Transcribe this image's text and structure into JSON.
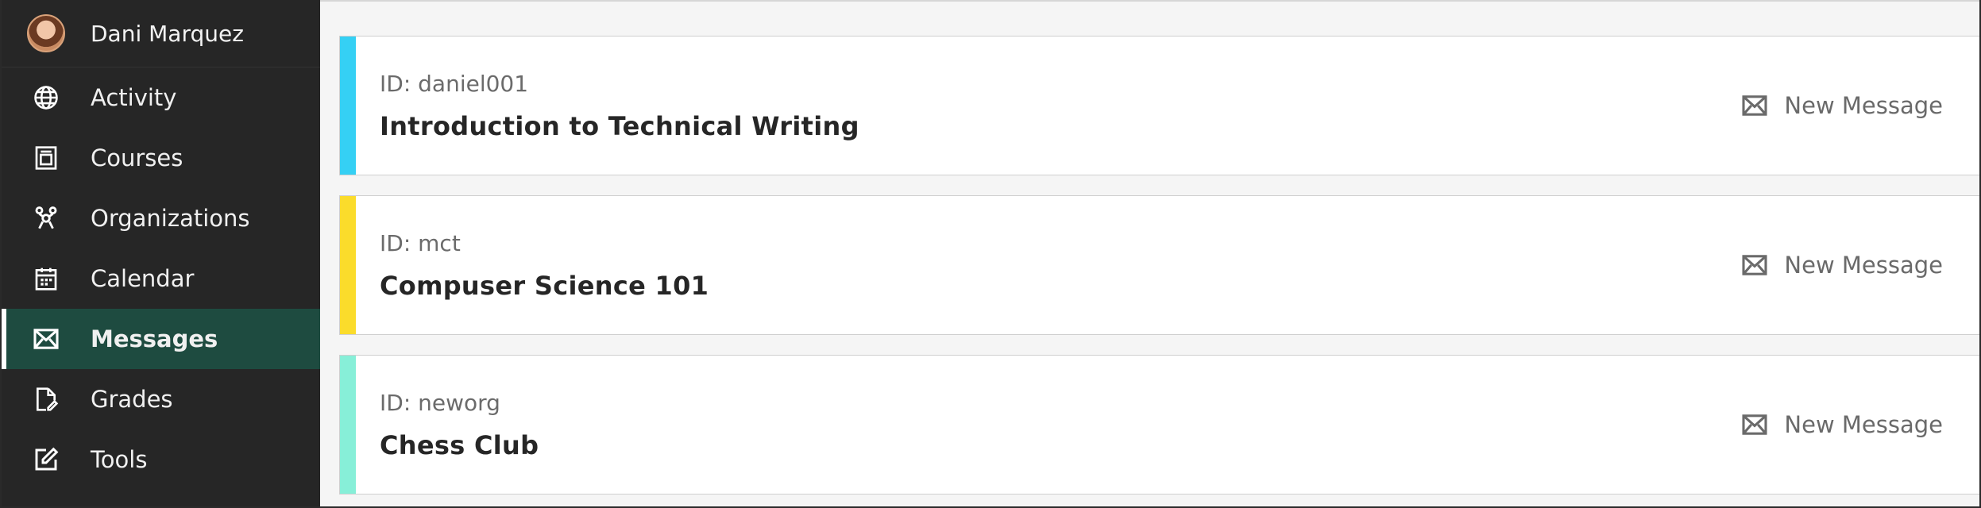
{
  "user": {
    "name": "Dani Marquez"
  },
  "nav": {
    "items": [
      {
        "label": "Activity",
        "icon": "globe-icon"
      },
      {
        "label": "Courses",
        "icon": "courses-icon"
      },
      {
        "label": "Organizations",
        "icon": "organizations-icon"
      },
      {
        "label": "Calendar",
        "icon": "calendar-icon"
      },
      {
        "label": "Messages",
        "icon": "envelope-icon",
        "active": true
      },
      {
        "label": "Grades",
        "icon": "grades-icon"
      },
      {
        "label": "Tools",
        "icon": "tools-icon"
      }
    ]
  },
  "courses": [
    {
      "id_text": "ID: daniel001",
      "title": "Introduction to Technical Writing",
      "color": "#35d0f4",
      "action": "New Message"
    },
    {
      "id_text": "ID: mct",
      "title": "Compuser Science 101",
      "color": "#fbdc2b",
      "action": "New Message"
    },
    {
      "id_text": "ID: neworg",
      "title": "Chess Club",
      "color": "#87efd8",
      "action": "New Message"
    }
  ],
  "colors": {
    "sidebar_bg": "#262626",
    "active_bg": "#1e4b40"
  }
}
